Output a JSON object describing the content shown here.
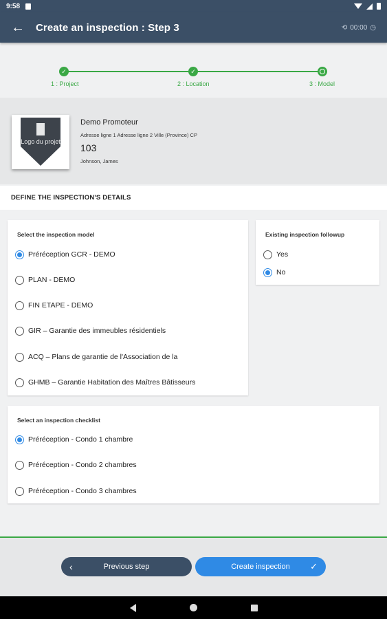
{
  "status_bar": {
    "time": "9:58"
  },
  "app_bar": {
    "title": "Create an inspection : Step 3",
    "timer": "00:00"
  },
  "stepper": {
    "steps": [
      {
        "label": "1 : Project"
      },
      {
        "label": "2 : Location"
      },
      {
        "label": "3 : Model"
      }
    ]
  },
  "project": {
    "logo_text": "Logo du projet",
    "name": "Demo Promoteur",
    "address": "Adresse ligne 1 Adresse ligne 2 Ville (Province) CP",
    "number": "103",
    "owner": "Johnson, James"
  },
  "section_title": "DEFINE THE INSPECTION'S DETAILS",
  "model_card": {
    "title": "Select the inspection model",
    "selected": "Préréception GCR - DEMO",
    "options": [
      "Préréception GCR - DEMO",
      "PLAN - DEMO",
      "FIN ETAPE - DEMO",
      "GIR – Garantie des immeubles résidentiels",
      "ACQ – Plans de garantie de l'Association de la",
      "GHMB – Garantie Habitation des Maîtres Bâtisseurs"
    ]
  },
  "followup_card": {
    "title": "Existing inspection followup",
    "selected": "No",
    "options": [
      "Yes",
      "No"
    ]
  },
  "checklist_card": {
    "title": "Select an inspection checklist",
    "selected": "Préréception - Condo 1 chambre",
    "options": [
      "Préréception - Condo 1 chambre",
      "Préréception - Condo 2 chambres",
      "Préréception - Condo 3 chambres"
    ]
  },
  "footer": {
    "previous_label": "Previous step",
    "create_label": "Create inspection"
  },
  "colors": {
    "appbar": "#3b4f66",
    "accent_green": "#3aa845",
    "primary_blue": "#2f8ae5"
  },
  "icons": {
    "back": "arrow-left-icon",
    "timer": "clock-icon",
    "sync": "sync-icon",
    "check": "check-icon"
  }
}
